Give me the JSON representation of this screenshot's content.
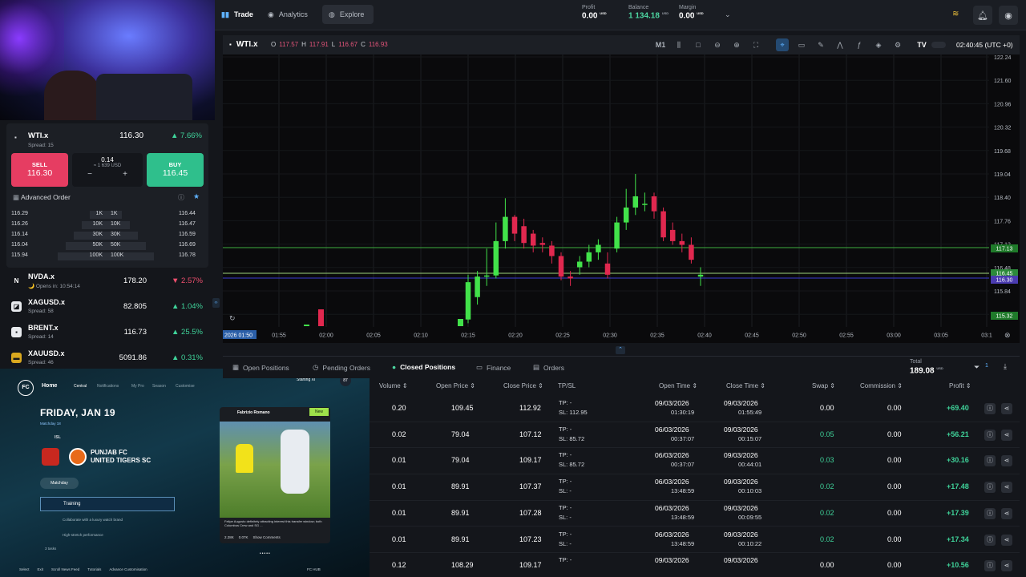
{
  "topbar": {
    "tabs": [
      {
        "label": "Trade",
        "active": true
      },
      {
        "label": "Analytics",
        "active": false
      },
      {
        "label": "Explore",
        "active": false
      }
    ],
    "profit_label": "Profit",
    "profit_value": "0.00",
    "profit_cur": "USD",
    "balance_label": "Balance",
    "balance_value": "1 134.18",
    "balance_cur": "USD",
    "margin_label": "Margin",
    "margin_value": "0.00",
    "margin_cur": "USD"
  },
  "chart": {
    "symbol": "WTI.x",
    "o_label": "O",
    "o": "117.57",
    "h_label": "H",
    "h": "117.91",
    "l_label": "L",
    "l": "116.67",
    "c_label": "C",
    "c": "116.93",
    "timeframe": "M1",
    "clock": "02:40:45 (UTC +0)",
    "y_ticks": [
      "122.24",
      "121.60",
      "120.96",
      "120.32",
      "119.68",
      "119.04",
      "118.40",
      "117.76",
      "117.12",
      "116.48",
      "115.84",
      "115.32"
    ],
    "x_ticks": [
      "01:55",
      "02:00",
      "02:05",
      "02:10",
      "02:15",
      "02:20",
      "02:25",
      "02:30",
      "02:35",
      "02:40",
      "02:45",
      "02:50",
      "02:55",
      "03:00",
      "03:05",
      "03:1"
    ],
    "x_start": "2026 01:50",
    "tags": [
      {
        "text": "117.13",
        "color": "#1f7a2a"
      },
      {
        "text": "116.45",
        "color": "#2c8a3a"
      },
      {
        "text": "116.30",
        "color": "#4a3bb0"
      },
      {
        "text": "115.32",
        "color": "#1f7a2a"
      }
    ]
  },
  "chart_data": {
    "type": "candlestick",
    "x": [
      "02:15",
      "02:16",
      "02:17",
      "02:18",
      "02:19",
      "02:20",
      "02:21",
      "02:22",
      "02:23",
      "02:24",
      "02:25",
      "02:26",
      "02:27",
      "02:28",
      "02:29",
      "02:30",
      "02:31",
      "02:32",
      "02:33",
      "02:34",
      "02:35",
      "02:36",
      "02:37",
      "02:38",
      "02:39",
      "02:40"
    ],
    "open": [
      115.3,
      115.9,
      116.45,
      116.48,
      117.4,
      118.05,
      117.8,
      117.6,
      117.35,
      117.28,
      117.0,
      116.45,
      116.7,
      116.85,
      117.1,
      116.8,
      117.2,
      117.9,
      118.3,
      118.4,
      118.6,
      118.2,
      117.7,
      117.4,
      117.3,
      116.45
    ],
    "close": [
      116.3,
      116.45,
      116.48,
      117.4,
      118.05,
      117.6,
      117.35,
      117.28,
      117.3,
      117.0,
      116.45,
      116.4,
      116.85,
      117.1,
      117.3,
      116.5,
      117.9,
      118.3,
      118.6,
      118.4,
      118.2,
      117.5,
      117.4,
      117.3,
      116.9,
      116.5
    ],
    "high": [
      116.5,
      116.6,
      117.2,
      117.9,
      118.55,
      118.1,
      118.0,
      117.7,
      117.5,
      117.4,
      117.1,
      116.6,
      117.0,
      117.3,
      117.45,
      117.1,
      118.05,
      118.8,
      119.2,
      118.7,
      118.7,
      118.3,
      117.9,
      117.6,
      117.5,
      116.7
    ],
    "low": [
      115.2,
      115.7,
      116.2,
      116.4,
      117.2,
      117.4,
      117.2,
      117.1,
      117.1,
      116.8,
      116.35,
      116.2,
      116.5,
      116.7,
      116.9,
      116.4,
      117.1,
      117.7,
      118.1,
      118.2,
      118.0,
      117.4,
      117.3,
      117.1,
      116.8,
      116.2
    ],
    "ylim": [
      115.1,
      122.4
    ],
    "lines": [
      117.13,
      116.45,
      116.3
    ]
  },
  "left": {
    "wti": {
      "sym": "WTI.x",
      "spread": "Spread: 15",
      "price": "116.30",
      "chg": "▲ 7.66%"
    },
    "sell_label": "SELL",
    "sell_price": "116.30",
    "buy_label": "BUY",
    "buy_price": "116.45",
    "lot": "0.14",
    "lot_usd": "≈ 1 639 USD",
    "minus": "−",
    "plus": "+",
    "advanced": "Advanced Order",
    "depth": [
      {
        "bid": "116.29",
        "bvol": "1K",
        "avol": "1K",
        "ask": "116.44"
      },
      {
        "bid": "116.26",
        "bvol": "10K",
        "avol": "10K",
        "ask": "116.47"
      },
      {
        "bid": "116.14",
        "bvol": "30K",
        "avol": "30K",
        "ask": "116.59"
      },
      {
        "bid": "116.04",
        "bvol": "50K",
        "avol": "50K",
        "ask": "116.69"
      },
      {
        "bid": "115.94",
        "bvol": "100K",
        "avol": "100K",
        "ask": "116.78"
      }
    ],
    "markets": [
      {
        "icon": "N",
        "sym": "NVDA.x",
        "sub": "🌙 Opens in: 10:54:14",
        "price": "178.20",
        "chg": "▼ 2.57%",
        "dir": "red"
      },
      {
        "icon": "◪",
        "sym": "XAGUSD.x",
        "sub": "Spread: 58",
        "price": "82.805",
        "chg": "▲ 1.04%",
        "dir": "green"
      },
      {
        "icon": "▪",
        "sym": "BRENT.x",
        "sub": "Spread: 14",
        "price": "116.73",
        "chg": "▲ 25.5%",
        "dir": "green"
      },
      {
        "icon": "▬",
        "sym": "XAUUSD.x",
        "sub": "Spread: 46",
        "price": "5091.86",
        "chg": "▲ 0.31%",
        "dir": "green"
      }
    ]
  },
  "positions": {
    "tabs": [
      "Open Positions",
      "Pending Orders",
      "Closed Positions",
      "Finance",
      "Orders"
    ],
    "total_label": "Total",
    "total_value": "189.08",
    "total_cur": "USD",
    "filter_count": "1",
    "columns": [
      "Volume",
      "Open Price",
      "Close Price",
      "TP/SL",
      "Open Time",
      "Close Time",
      "Swap",
      "Commission",
      "Profit"
    ],
    "rows": [
      {
        "vol": "0.20",
        "open": "109.45",
        "close": "112.92",
        "tp": "TP: -",
        "sl": "SL: 112.95",
        "od": "09/03/2026",
        "ot": "01:30:19",
        "cd": "09/03/2026",
        "ct": "01:55:49",
        "swap": "0.00",
        "comm": "0.00",
        "profit": "+69.40"
      },
      {
        "vol": "0.02",
        "open": "79.04",
        "close": "107.12",
        "tp": "TP: -",
        "sl": "SL: 85.72",
        "od": "06/03/2026",
        "ot": "00:37:07",
        "cd": "09/03/2026",
        "ct": "00:15:07",
        "swap": "0.05",
        "comm": "0.00",
        "profit": "+56.21"
      },
      {
        "vol": "0.01",
        "open": "79.04",
        "close": "109.17",
        "tp": "TP: -",
        "sl": "SL: 85.72",
        "od": "06/03/2026",
        "ot": "00:37:07",
        "cd": "09/03/2026",
        "ct": "00:44:01",
        "swap": "0.03",
        "comm": "0.00",
        "profit": "+30.16"
      },
      {
        "vol": "0.01",
        "open": "89.91",
        "close": "107.37",
        "tp": "TP: -",
        "sl": "SL: -",
        "od": "06/03/2026",
        "ot": "13:48:59",
        "cd": "09/03/2026",
        "ct": "00:10:03",
        "swap": "0.02",
        "comm": "0.00",
        "profit": "+17.48"
      },
      {
        "vol": "0.01",
        "open": "89.91",
        "close": "107.28",
        "tp": "TP: -",
        "sl": "SL: -",
        "od": "06/03/2026",
        "ot": "13:48:59",
        "cd": "09/03/2026",
        "ct": "00:09:55",
        "swap": "0.02",
        "comm": "0.00",
        "profit": "+17.39"
      },
      {
        "vol": "0.01",
        "open": "89.91",
        "close": "107.23",
        "tp": "TP: -",
        "sl": "SL: -",
        "od": "06/03/2026",
        "ot": "13:48:59",
        "cd": "09/03/2026",
        "ct": "00:10:22",
        "swap": "0.02",
        "comm": "0.00",
        "profit": "+17.34"
      },
      {
        "vol": "0.12",
        "open": "108.29",
        "close": "109.17",
        "tp": "TP: -",
        "sl": "",
        "od": "09/03/2026",
        "ot": "",
        "cd": "09/03/2026",
        "ct": "",
        "swap": "0.00",
        "comm": "0.00",
        "profit": "+10.56"
      }
    ]
  },
  "game": {
    "home": "Home",
    "nav": [
      "Central",
      "Notifications",
      "My Pro",
      "Season",
      "Customise"
    ],
    "date": "FRIDAY, JAN 19",
    "matchday": "Matchday 18",
    "league": "ISL",
    "team1": "PUNJAB FC",
    "team2": "UNITED TIGERS SC",
    "matchday_btn": "Matchday",
    "training": "Training",
    "sub1": "Collaborate with a luxury watch brand",
    "sub2": "High-stretch performance",
    "tasks": "3 tasks",
    "starting": "Starting XI",
    "rating": "87",
    "card_author": "Fabrizio Romano",
    "card_badge": "New",
    "card_text": "Felipe Augusto definitely attracting interest this transfer window; both Columbus Crew and SG ...",
    "likes": "2.28K",
    "shares": "0.07K",
    "comments": "Show Comments",
    "footer": [
      "Select",
      "Exit",
      "Scroll News Feed",
      "Tutorials",
      "Advance Customisation"
    ],
    "fc_hub": "FC HUB"
  }
}
